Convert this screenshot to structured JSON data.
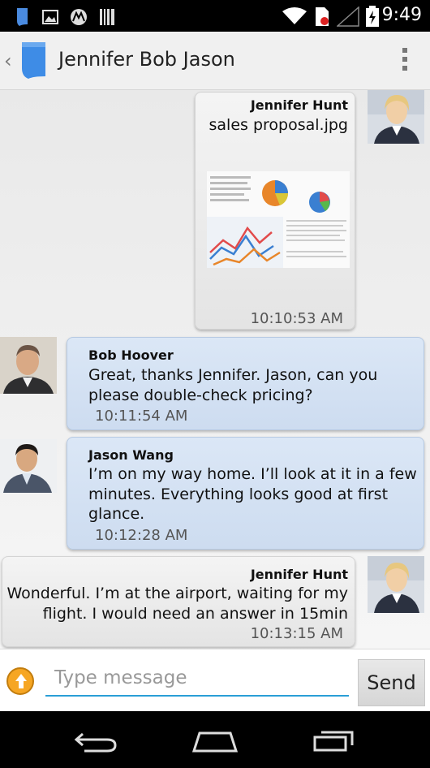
{
  "status_bar": {
    "time": "9:49",
    "icons": [
      "app-icon",
      "gallery-icon",
      "motorola-icon",
      "barcode-icon",
      "wifi-icon",
      "no-sim-icon",
      "signal-icon",
      "battery-icon"
    ]
  },
  "action_bar": {
    "back_icon": "‹",
    "title": "Jennifer Bob Jason",
    "menu_icon": "overflow-menu-icon"
  },
  "messages": [
    {
      "sender": "Jennifer Hunt",
      "text": "sales proposal.jpg",
      "timestamp": "10:10:53 AM",
      "direction": "outgoing",
      "attachment": "sales proposal chart image"
    },
    {
      "sender": "Bob Hoover",
      "text": "Great, thanks Jennifer. Jason, can you please double-check pricing?",
      "line1": "Great, thanks Jennifer. Jason, can you",
      "line2": "please double-check pricing?",
      "timestamp": "10:11:54 AM",
      "direction": "incoming"
    },
    {
      "sender": "Jason Wang",
      "line1": "I’m on my way home. I’ll look at it in a few",
      "line2": "minutes. Everything looks good at first",
      "line3": "glance.",
      "timestamp": "10:12:28 AM",
      "direction": "incoming"
    },
    {
      "sender": "Jennifer Hunt",
      "line1": "Wonderful. I’m at the airport, waiting for my",
      "line2": "flight. I would need an answer in 15min",
      "timestamp": "10:13:15 AM",
      "direction": "outgoing"
    }
  ],
  "composer": {
    "placeholder": "Type message",
    "value": "",
    "send_label": "Send",
    "attach_icon": "upload-arrow-icon"
  },
  "nav_bar": {
    "icons": [
      "back-icon",
      "home-icon",
      "recents-icon"
    ]
  },
  "colors": {
    "outgoing_bubble": "#e8e8e8",
    "incoming_bubble": "#d3e1f3",
    "input_underline": "#2a9fd6",
    "attach_button": "#f6a623"
  }
}
